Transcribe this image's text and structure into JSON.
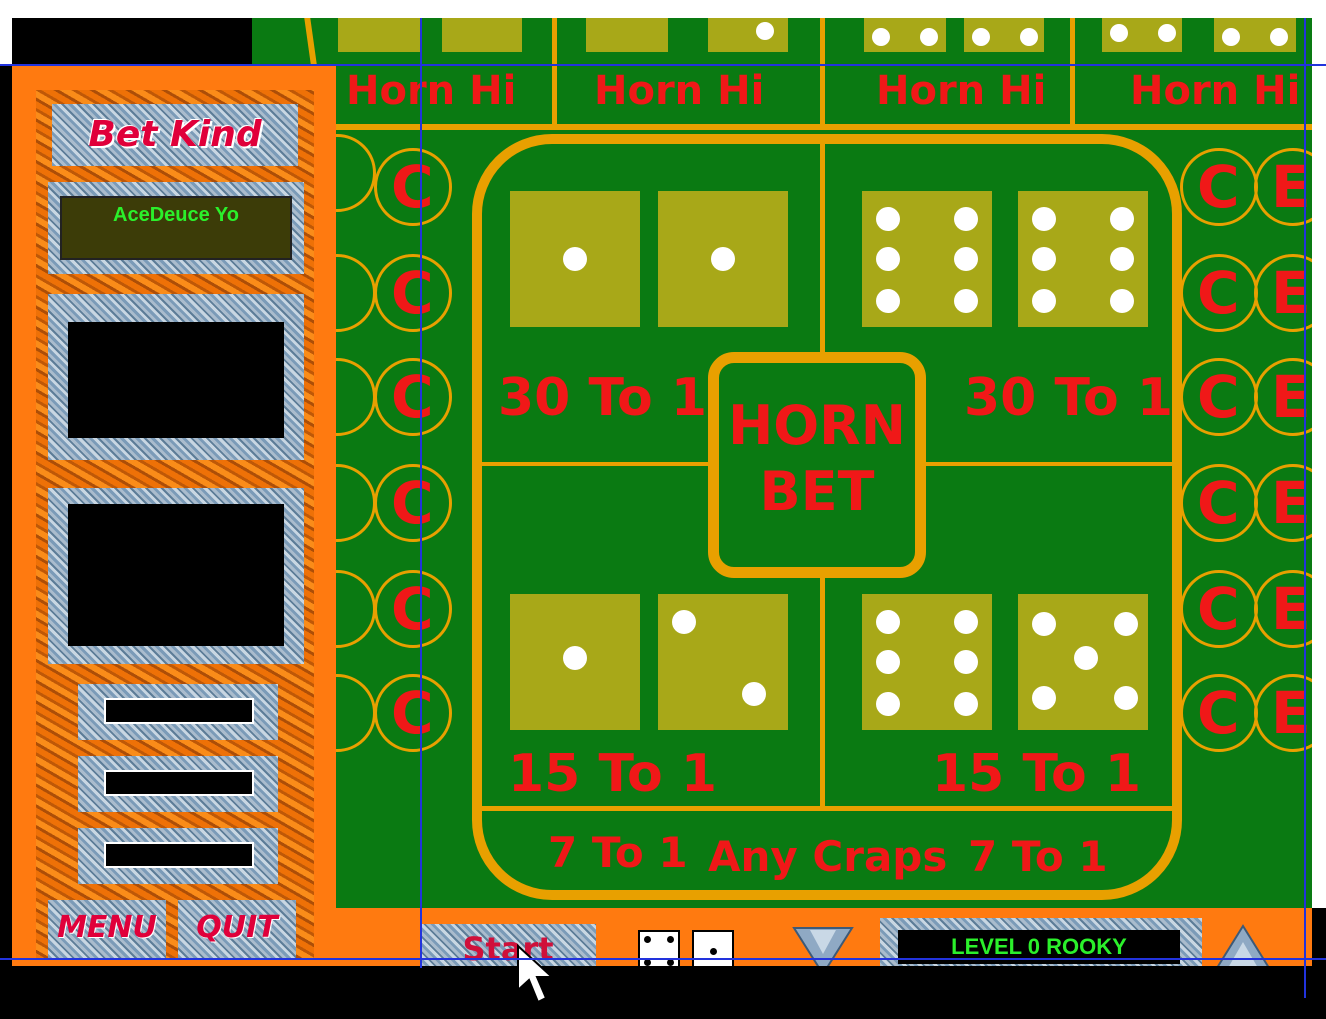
{
  "panel": {
    "title": "Bet Kind",
    "bet_name": "AceDeuce Yo",
    "menu_label": "MENU",
    "quit_label": "QUIT"
  },
  "table": {
    "horn_hi_labels": [
      "Horn Hi",
      "Horn Hi",
      "Horn Hi",
      "Horn Hi"
    ],
    "come_letter": "C",
    "edge_letter": "E",
    "center_label_1": "HORN",
    "center_label_2": "BET",
    "odds_top_left": "30 To 1",
    "odds_top_right": "30 To 1",
    "odds_bottom_left": "15 To 1",
    "odds_bottom_right": "15 To 1",
    "any_craps_left": "7 To 1",
    "any_craps_label": "Any Craps",
    "any_craps_right": "7 To 1"
  },
  "bottom": {
    "start_label": "Start",
    "level_text": "LEVEL 0  ROOKY"
  },
  "colors": {
    "felt": "#0a7a12",
    "trim": "#e8a000",
    "text_red": "#f01818",
    "panel_orange": "#ff7a10",
    "lcd_green": "#2bf02b"
  }
}
